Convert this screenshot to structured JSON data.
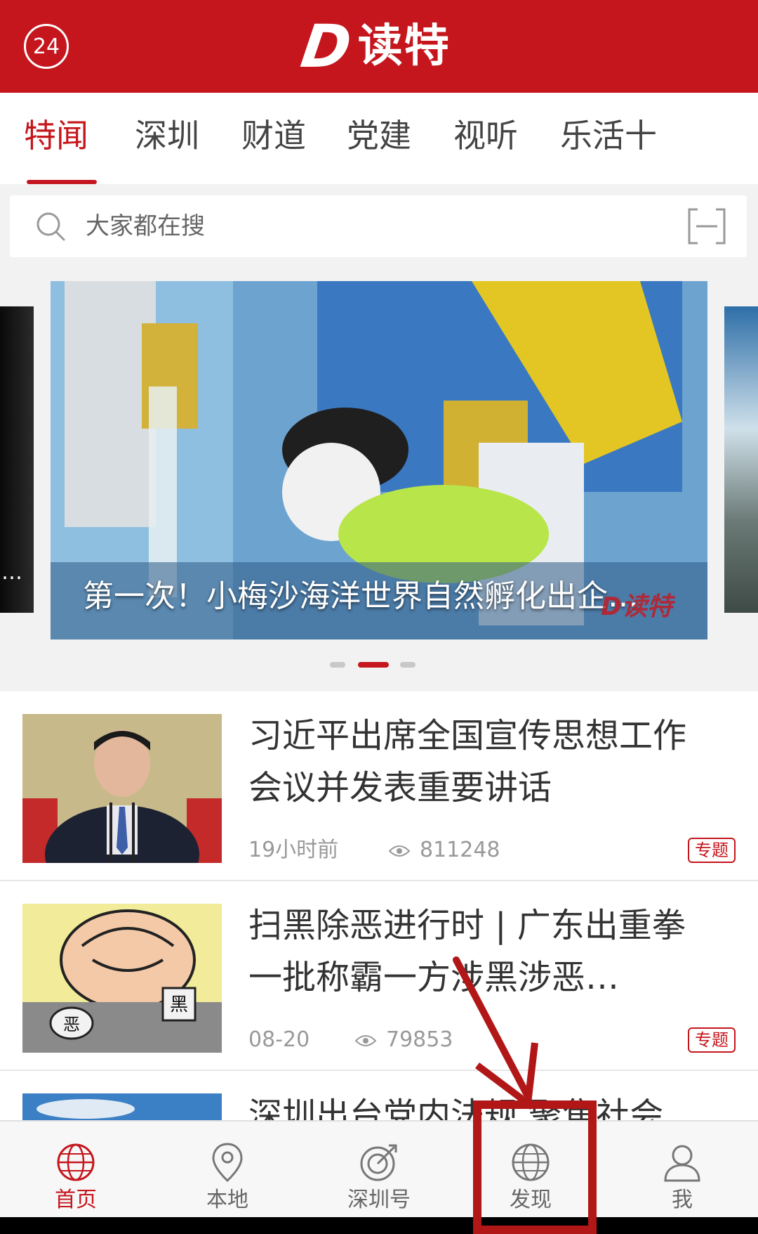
{
  "header": {
    "badge": "24",
    "logo_d": "D",
    "logo_text": "读特"
  },
  "tabs": [
    {
      "label": "特闻",
      "active": true
    },
    {
      "label": "深圳"
    },
    {
      "label": "财道"
    },
    {
      "label": "党建"
    },
    {
      "label": "视听"
    },
    {
      "label": "乐活十"
    }
  ],
  "search": {
    "placeholder": "大家都在搜"
  },
  "carousel": {
    "caption": "第一次！小梅沙海洋世界自然孵化出企…",
    "watermark": "D读特",
    "left_caption": "…",
    "active_index": 1,
    "count": 3
  },
  "news": [
    {
      "title": "习近平出席全国宣传思想工作会议并发表重要讲话",
      "time": "19小时前",
      "views": "811248",
      "tag": "专题"
    },
    {
      "title": "扫黑除恶进行时 | 广东出重拳 一批称霸一方涉黑涉恶…",
      "time": "08-20",
      "views": "79853",
      "tag": "专题"
    },
    {
      "title": "深圳出台党内法规 聚焦社会"
    }
  ],
  "bottom_nav": [
    {
      "label": "首页",
      "icon": "globe-icon",
      "active": true
    },
    {
      "label": "本地",
      "icon": "location-pin-icon"
    },
    {
      "label": "深圳号",
      "icon": "target-icon"
    },
    {
      "label": "发现",
      "icon": "globe-icon"
    },
    {
      "label": "我",
      "icon": "user-icon"
    }
  ],
  "colors": {
    "brand": "#c5161d",
    "annotation": "#b11717"
  }
}
